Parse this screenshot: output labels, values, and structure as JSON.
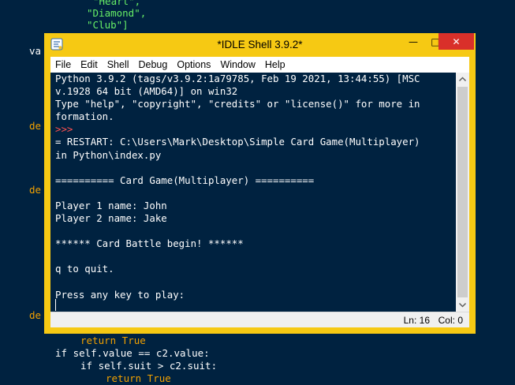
{
  "background_editor": {
    "lines_top": [
      {
        "text": "\"Heart\",",
        "cls": "str"
      },
      {
        "text": "\"Diamond\",",
        "cls": "str"
      },
      {
        "text": "\"Club\"]",
        "cls": "str"
      }
    ],
    "side_fragments": [
      "va",
      "de",
      "de",
      "de"
    ],
    "lines_bottom": [
      {
        "text": "return True",
        "cls": "kw-ret"
      },
      {
        "text": "if self.value == c2.value:",
        "cls": "plain"
      },
      {
        "text": "if self.suit > c2.suit:",
        "cls": "plain"
      },
      {
        "text": "return True",
        "cls": "kw-ret"
      }
    ]
  },
  "window": {
    "title": "*IDLE Shell 3.9.2*",
    "minimize_glyph": "—",
    "maximize_glyph": "□",
    "close_glyph": "✕"
  },
  "menu": [
    "File",
    "Edit",
    "Shell",
    "Debug",
    "Options",
    "Window",
    "Help"
  ],
  "shell": {
    "lines": [
      {
        "text": "Python 3.9.2 (tags/v3.9.2:1a79785, Feb 19 2021, 13:44:55) [MSC",
        "cls": ""
      },
      {
        "text": "v.1928 64 bit (AMD64)] on win32",
        "cls": ""
      },
      {
        "text": "Type \"help\", \"copyright\", \"credits\" or \"license()\" for more in",
        "cls": ""
      },
      {
        "text": "formation.",
        "cls": ""
      },
      {
        "text": ">>>",
        "cls": "prompt"
      },
      {
        "text": "= RESTART: C:\\Users\\Mark\\Desktop\\Simple Card Game(Multiplayer)",
        "cls": ""
      },
      {
        "text": "in Python\\index.py",
        "cls": ""
      },
      {
        "text": "",
        "cls": ""
      },
      {
        "text": "========== Card Game(Multiplayer) ==========",
        "cls": ""
      },
      {
        "text": "",
        "cls": ""
      },
      {
        "text": "Player 1 name: John",
        "cls": ""
      },
      {
        "text": "Player 2 name: Jake",
        "cls": ""
      },
      {
        "text": "",
        "cls": ""
      },
      {
        "text": "****** Card Battle begin! ******",
        "cls": ""
      },
      {
        "text": "",
        "cls": ""
      },
      {
        "text": "q to quit.",
        "cls": ""
      },
      {
        "text": "",
        "cls": ""
      },
      {
        "text": "Press any key to play:",
        "cls": ""
      }
    ]
  },
  "status": {
    "line": "Ln: 16",
    "col": "Col: 0"
  },
  "colors": {
    "window_border": "#f6c913",
    "shell_bg": "#002240",
    "prompt": "#ff5050",
    "close": "#d9302a"
  }
}
